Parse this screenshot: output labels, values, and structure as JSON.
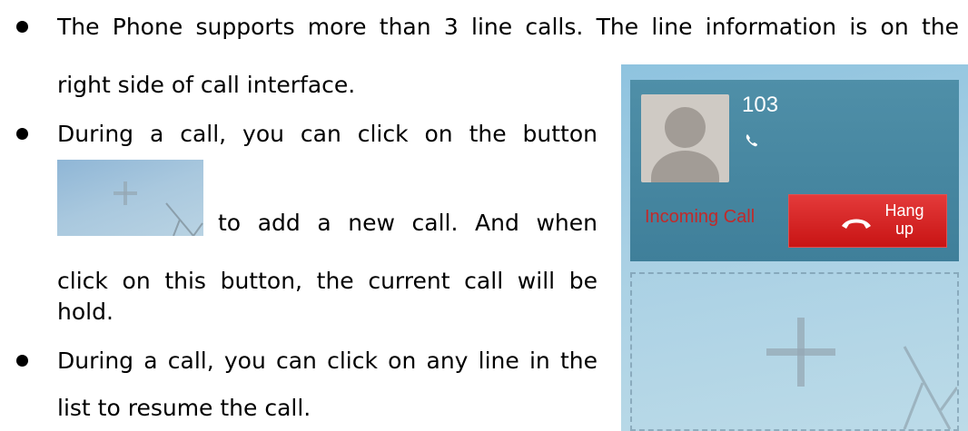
{
  "bullets": [
    {
      "lines": [
        "The Phone supports more than 3 line calls. The line information is on the",
        "right side of call interface."
      ]
    },
    {
      "lines": [
        "During a call, you can click on the button",
        "to add a new call. And when",
        "click on this button, the current call will be",
        "hold."
      ]
    },
    {
      "lines": [
        "During a call, you can click on any line in the",
        "list to resume the call."
      ]
    }
  ],
  "phone": {
    "caller_number": "103",
    "status": "Incoming Call",
    "hangup_label": "Hang up",
    "icons": {
      "avatar": "avatar-icon",
      "call": "phone-icon",
      "hangup": "hangup-icon",
      "add": "plus-icon"
    }
  },
  "colors": {
    "hangup_button": "#d21f1f",
    "status_text": "#c12a2a",
    "card_background": "#4a8aa3"
  }
}
